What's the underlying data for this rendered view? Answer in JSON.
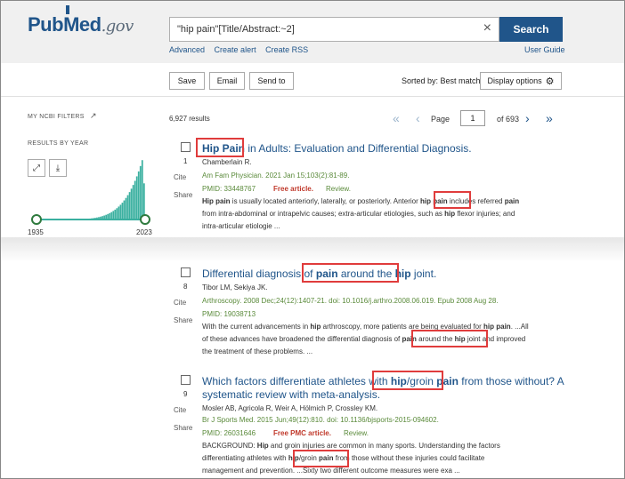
{
  "header": {
    "logo_main_a": "Pub",
    "logo_main_b": "Med",
    "logo_gov": ".gov",
    "search_value": "\"hip pain\"[Title/Abstract:~2]",
    "clear_icon": "×",
    "search_button": "Search",
    "sub_links": [
      "Advanced",
      "Create alert",
      "Create RSS"
    ],
    "user_guide": "User Guide"
  },
  "toolbar": {
    "save": "Save",
    "email": "Email",
    "send_to": "Send to",
    "sorted_by": "Sorted by: Best match",
    "display_options": "Display options"
  },
  "sidebar": {
    "my_ncbi_filters": "MY NCBI FILTERS",
    "results_by_year": "RESULTS BY YEAR",
    "year_start": "1935",
    "year_end": "2023",
    "accent_color": "#3bb0a0"
  },
  "results": {
    "count": "6,927 results",
    "page_label": "Page",
    "page_value": "1",
    "page_of": "of 693"
  },
  "articles": [
    {
      "number": "1",
      "title_a": "Hip Pain",
      "title_b": " in Adults: Evaluation and Differential Diagnosis.",
      "authors": "Chamberlain R.",
      "journal": "Am Fam Physician. 2021 Jan 15;103(2):81-89.",
      "pmid": "PMID: 33448767",
      "free": "Free article.",
      "review": "Review.",
      "snip1_a": "Hip pain",
      "snip1_b": " is usually located anteriorly, laterally, or posteriorly. Anterior ",
      "snip1_c": "hip pain",
      "snip1_d": " includes referred ",
      "snip1_e": "pain",
      "snip2": "from intra-abdominal or intrapelvic causes; extra-articular etiologies, such as ",
      "snip2_b": "hip",
      "snip2_c": " flexor injuries; and",
      "snip3": "intra-articular etiologie ..."
    },
    {
      "number": "8",
      "title_a": "Differential diagnosis of ",
      "title_b": "pain",
      "title_c": " around the ",
      "title_d": "hip",
      "title_e": " joint.",
      "authors": "Tibor LM, Sekiya JK.",
      "journal": "Arthroscopy. 2008 Dec;24(12):1407-21. doi: 10.1016/j.arthro.2008.06.019. Epub 2008 Aug 28.",
      "pmid": "PMID: 19038713",
      "snip1_a": "With the current advancements in ",
      "snip1_b": "hip",
      "snip1_c": " arthroscopy, more patients are being evaluated for ",
      "snip1_d": "hip pain",
      "snip1_e": ". ...All",
      "snip2_a": "of these advances have broadened the differential diagnosis of ",
      "snip2_b": "pain",
      "snip2_c": " around the ",
      "snip2_d": "hip",
      "snip2_e": " joint and improved",
      "snip3": "the treatment of these problems. ..."
    },
    {
      "number": "9",
      "title_a": "Which factors differentiate athletes with ",
      "title_b": "hip",
      "title_c": "/groin ",
      "title_d": "pain",
      "title_e": " from those without? A",
      "title_line2": "systematic review with meta-analysis.",
      "authors": "Mosler AB, Agricola R, Weir A, Hölmich P, Crossley KM.",
      "journal": "Br J Sports Med. 2015 Jun;49(12):810. doi: 10.1136/bjsports-2015-094602.",
      "pmid": "PMID: 26031646",
      "free": "Free PMC article.",
      "review": "Review.",
      "snip1_a": "BACKGROUND: ",
      "snip1_b": "Hip",
      "snip1_c": " and groin injuries are common in many sports. Understanding the factors",
      "snip2_a": "differentiating athletes with ",
      "snip2_b": "hip",
      "snip2_c": "/groin ",
      "snip2_d": "pain",
      "snip2_e": " from those without these injuries could facilitate",
      "snip3": "management and prevention. ...Sixty two different outcome measures were exa ..."
    }
  ],
  "cite_label": "Cite",
  "share_label": "Share",
  "highlight_color": "#e03c3c"
}
